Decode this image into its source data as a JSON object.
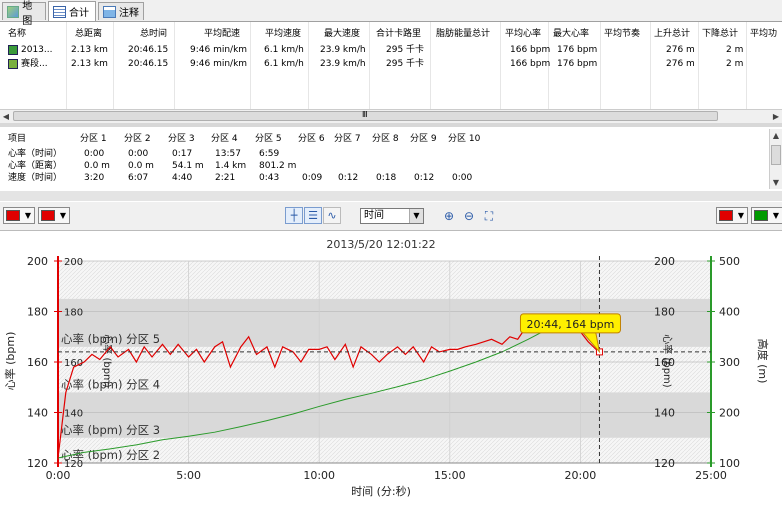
{
  "tabs": [
    {
      "label": "地图",
      "icon": "map-icon"
    },
    {
      "label": "合计",
      "icon": "table-icon"
    },
    {
      "label": "注释",
      "icon": "note-icon"
    }
  ],
  "summary": {
    "columns": [
      "名称",
      "总距离",
      "总时间",
      "平均配速",
      "平均速度",
      "最大速度",
      "合计卡路里",
      "脂肪能量总计",
      "平均心率",
      "最大心率",
      "平均节奏",
      "上升总计",
      "下降总计",
      "平均功"
    ],
    "rows": [
      {
        "icon": "run-icon",
        "cells": [
          "2013...",
          "2.13 km",
          "20:46.15",
          "9:46 min/km",
          "6.1 km/h",
          "23.9 km/h",
          "295 千卡",
          "",
          "166 bpm",
          "176 bpm",
          "",
          "276 m",
          "2 m",
          ""
        ]
      },
      {
        "icon": "segment-icon",
        "cells": [
          "赛段...",
          "2.13 km",
          "20:46.15",
          "9:46 min/km",
          "6.1 km/h",
          "23.9 km/h",
          "295 千卡",
          "",
          "166 bpm",
          "176 bpm",
          "",
          "276 m",
          "2 m",
          ""
        ]
      }
    ],
    "scroll_mark": "Ⅲ"
  },
  "zones": {
    "columns": [
      "项目",
      "分区 1",
      "分区 2",
      "分区 3",
      "分区 4",
      "分区 5",
      "分区 6",
      "分区 7",
      "分区 8",
      "分区 9",
      "分区 10"
    ],
    "rows": [
      [
        "心率（时间）",
        "0:00",
        "0:00",
        "0:17",
        "13:57",
        "6:59",
        "",
        "",
        "",
        "",
        ""
      ],
      [
        "心率（距离）",
        "0.0 m",
        "0.0 m",
        "54.1 m",
        "1.4 km",
        "801.2 m",
        "",
        "",
        "",
        "",
        ""
      ],
      [
        "速度（时间）",
        "3:20",
        "6:07",
        "4:40",
        "2:21",
        "0:43",
        "0:09",
        "0:12",
        "0:18",
        "0:12",
        "0:00"
      ]
    ]
  },
  "toolbar": {
    "x_axis_select": "时间",
    "left_color_1": "#e00000",
    "left_color_2": "#e00000",
    "right_color_1": "#e00000",
    "right_color_2": "#009900"
  },
  "chart_data": {
    "type": "line",
    "title": "2013/5/20 12:01:22",
    "xlabel": "时间 (分:秒)",
    "ylabel_left": "心率 (bpm)",
    "ylabel_left_inner": "心率 (bpm)",
    "ylabel_right_inner": "心率 (bpm)",
    "ylabel_right": "高度 (m)",
    "x_ticks": [
      "0:00",
      "5:00",
      "10:00",
      "15:00",
      "20:00",
      "25:00"
    ],
    "xlim_minutes": [
      0,
      25
    ],
    "ylim_hr": [
      120,
      200
    ],
    "y_ticks_hr": [
      "120",
      "140",
      "160",
      "180",
      "200"
    ],
    "ylim_alt": [
      100,
      500
    ],
    "y_ticks_alt": [
      "100",
      "200",
      "300",
      "400",
      "500"
    ],
    "zones": [
      {
        "label": "心率 (bpm) 分区 2",
        "from": 120,
        "to": 130
      },
      {
        "label": "心率 (bpm) 分区 3",
        "from": 130,
        "to": 148
      },
      {
        "label": "心率 (bpm) 分区 4",
        "from": 148,
        "to": 166
      },
      {
        "label": "心率 (bpm) 分区 5",
        "from": 166,
        "to": 185
      }
    ],
    "series": [
      {
        "color": "#e00000",
        "x": [
          0.0,
          0.3,
          0.6,
          1.0,
          1.3,
          1.6,
          2.0,
          2.3,
          2.7,
          3.0,
          3.3,
          3.6,
          4.0,
          4.3,
          4.6,
          5.0,
          5.3,
          5.6,
          6.0,
          6.3,
          6.6,
          7.0,
          7.3,
          7.6,
          8.0,
          8.3,
          8.6,
          9.0,
          9.3,
          9.6,
          10.0,
          10.3,
          10.6,
          11.0,
          11.3,
          11.6,
          12.0,
          12.3,
          12.6,
          13.0,
          13.3,
          13.6,
          14.0,
          14.3,
          14.6,
          15.0,
          15.3,
          15.6,
          16.0,
          16.3,
          16.6,
          17.0,
          17.3,
          17.6,
          18.0,
          18.3,
          18.6,
          19.0,
          19.3,
          19.6,
          20.0,
          20.3,
          20.7
        ],
        "y": [
          122,
          148,
          158,
          160,
          163,
          161,
          166,
          162,
          165,
          160,
          166,
          162,
          167,
          163,
          167,
          162,
          165,
          160,
          166,
          168,
          158,
          166,
          170,
          163,
          166,
          158,
          166,
          164,
          160,
          165,
          165,
          166,
          161,
          167,
          158,
          166,
          163,
          160,
          163,
          166,
          163,
          166,
          160,
          166,
          164,
          165,
          165,
          166,
          167,
          168,
          169,
          167,
          170,
          169,
          175,
          173,
          177,
          176,
          178,
          175,
          172,
          168,
          164
        ]
      },
      {
        "color": "#2a9a2a",
        "x": [
          0,
          1,
          2,
          3,
          4,
          5,
          6,
          7,
          8,
          9,
          10,
          11,
          12,
          13,
          14,
          15,
          16,
          17,
          18,
          19,
          20,
          20.7
        ],
        "y": [
          110,
          121,
          128,
          136,
          146,
          153,
          161,
          172,
          184,
          197,
          212,
          226,
          238,
          251,
          265,
          282,
          300,
          320,
          345,
          372,
          392,
          395
        ]
      }
    ],
    "marker": {
      "x": 20.73,
      "y": 164,
      "label": "20:44, 164 bpm"
    }
  }
}
